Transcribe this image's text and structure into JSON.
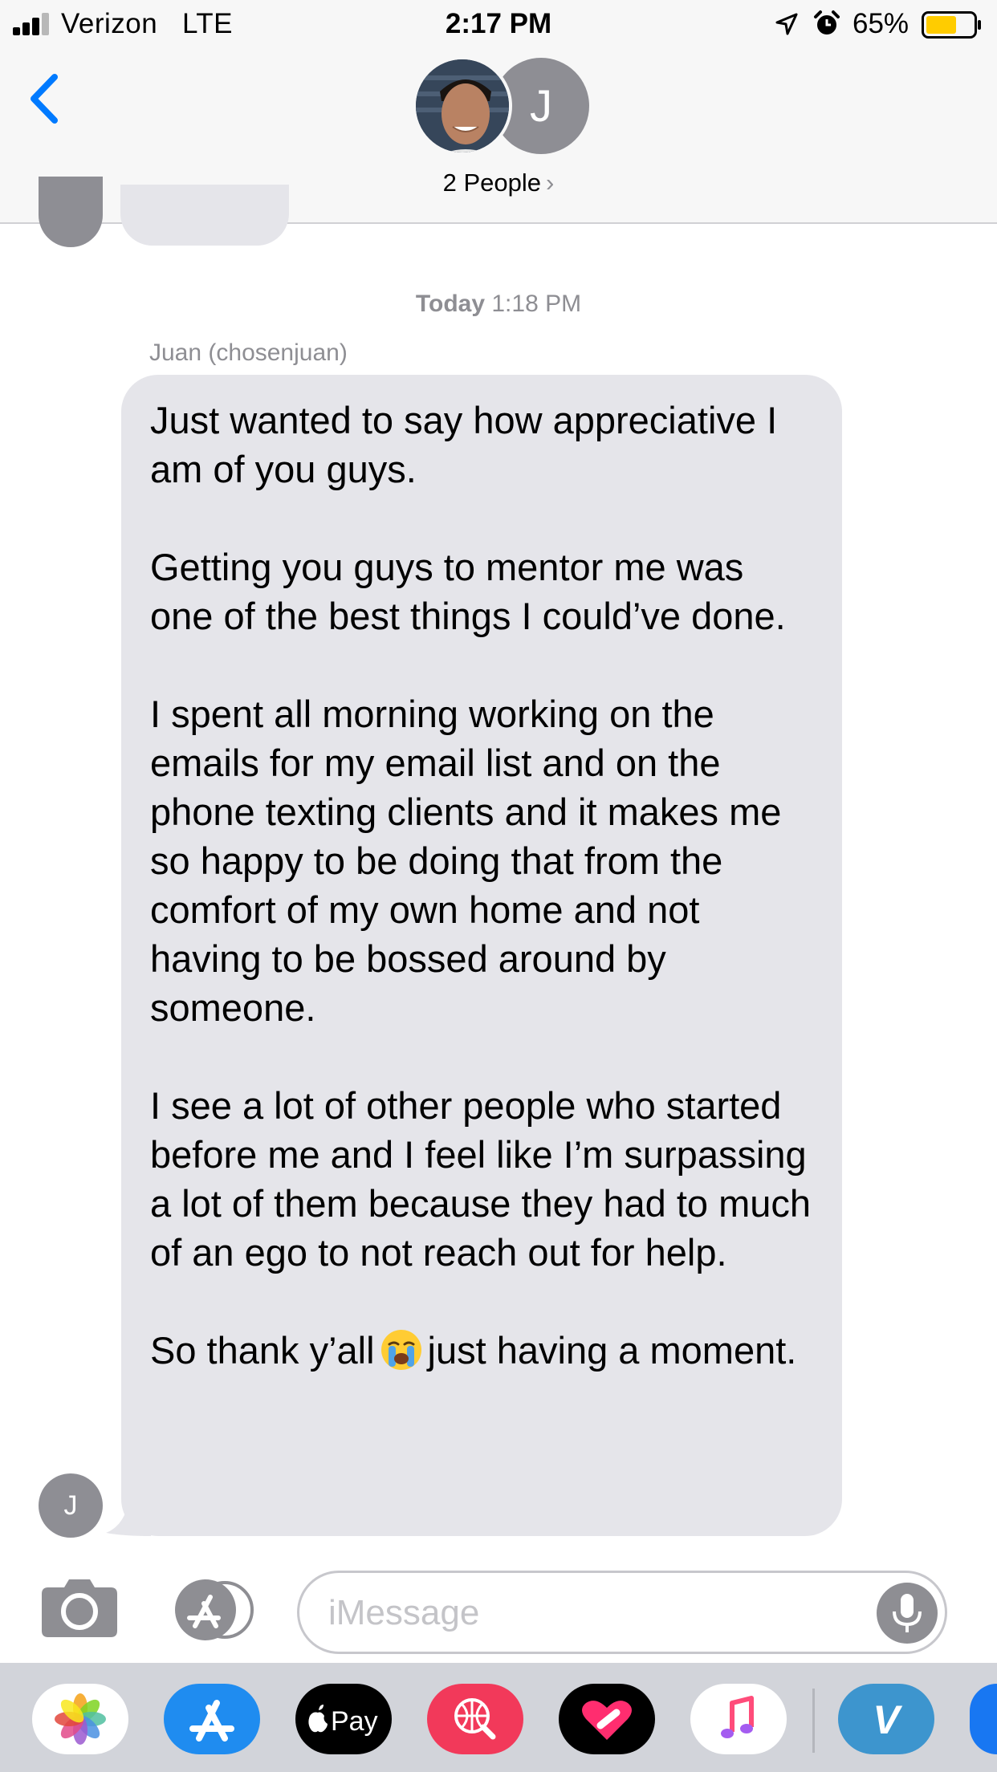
{
  "status_bar": {
    "carrier": "Verizon",
    "network": "LTE",
    "time": "2:17 PM",
    "battery_percent": "65%",
    "battery_level": 0.65,
    "icons": [
      "signal-bars-icon",
      "location-arrow-icon",
      "alarm-icon",
      "battery-icon"
    ]
  },
  "header": {
    "group_avatar_initial": "J",
    "participants_label": "2 People",
    "chevron": "›",
    "icons": [
      "back-chevron-icon"
    ]
  },
  "conversation": {
    "timestamp_day": "Today",
    "timestamp_time": "1:18 PM",
    "sender_name": "Juan (chosenjuan)",
    "sender_initial": "J",
    "message": {
      "p1": "Just wanted to say how appreciative I am of you guys.",
      "p2": "Getting you guys to mentor me was one of the best things I could’ve done.",
      "p3": "I spent all morning working on the emails for my email list and on the phone texting clients and it makes me so happy to be doing that from the comfort of my own home and not having to be bossed around by someone.",
      "p4": "I see a lot of other people who started before me and I feel like I’m surpassing a lot of them because they had to much of an ego to not reach out for help.",
      "p5_before": "So thank y’all",
      "p5_emoji": "loudly-crying-face-emoji",
      "p5_after": "just having a moment."
    },
    "bubble_color": "#e5e5ea"
  },
  "input_bar": {
    "placeholder": "iMessage",
    "value": "",
    "icons": [
      "camera-icon",
      "app-store-icon",
      "microphone-icon"
    ]
  },
  "app_drawer": {
    "apps": [
      {
        "name": "Photos",
        "icon": "photos-icon"
      },
      {
        "name": "App Store",
        "icon": "app-store-icon"
      },
      {
        "name": "Apple Pay",
        "label": "Pay",
        "icon": "apple-pay-icon"
      },
      {
        "name": "Search Images",
        "icon": "globe-search-icon"
      },
      {
        "name": "Digital Touch",
        "icon": "digital-touch-heart-icon"
      },
      {
        "name": "Music",
        "icon": "music-note-icon"
      },
      {
        "name": "Venmo",
        "label": "V",
        "icon": "venmo-icon"
      }
    ]
  },
  "colors": {
    "accent": "#007aff",
    "avatar_gray": "#8e8e94",
    "secondary_text": "#8e8e93",
    "battery_fill": "#ffcc00"
  }
}
